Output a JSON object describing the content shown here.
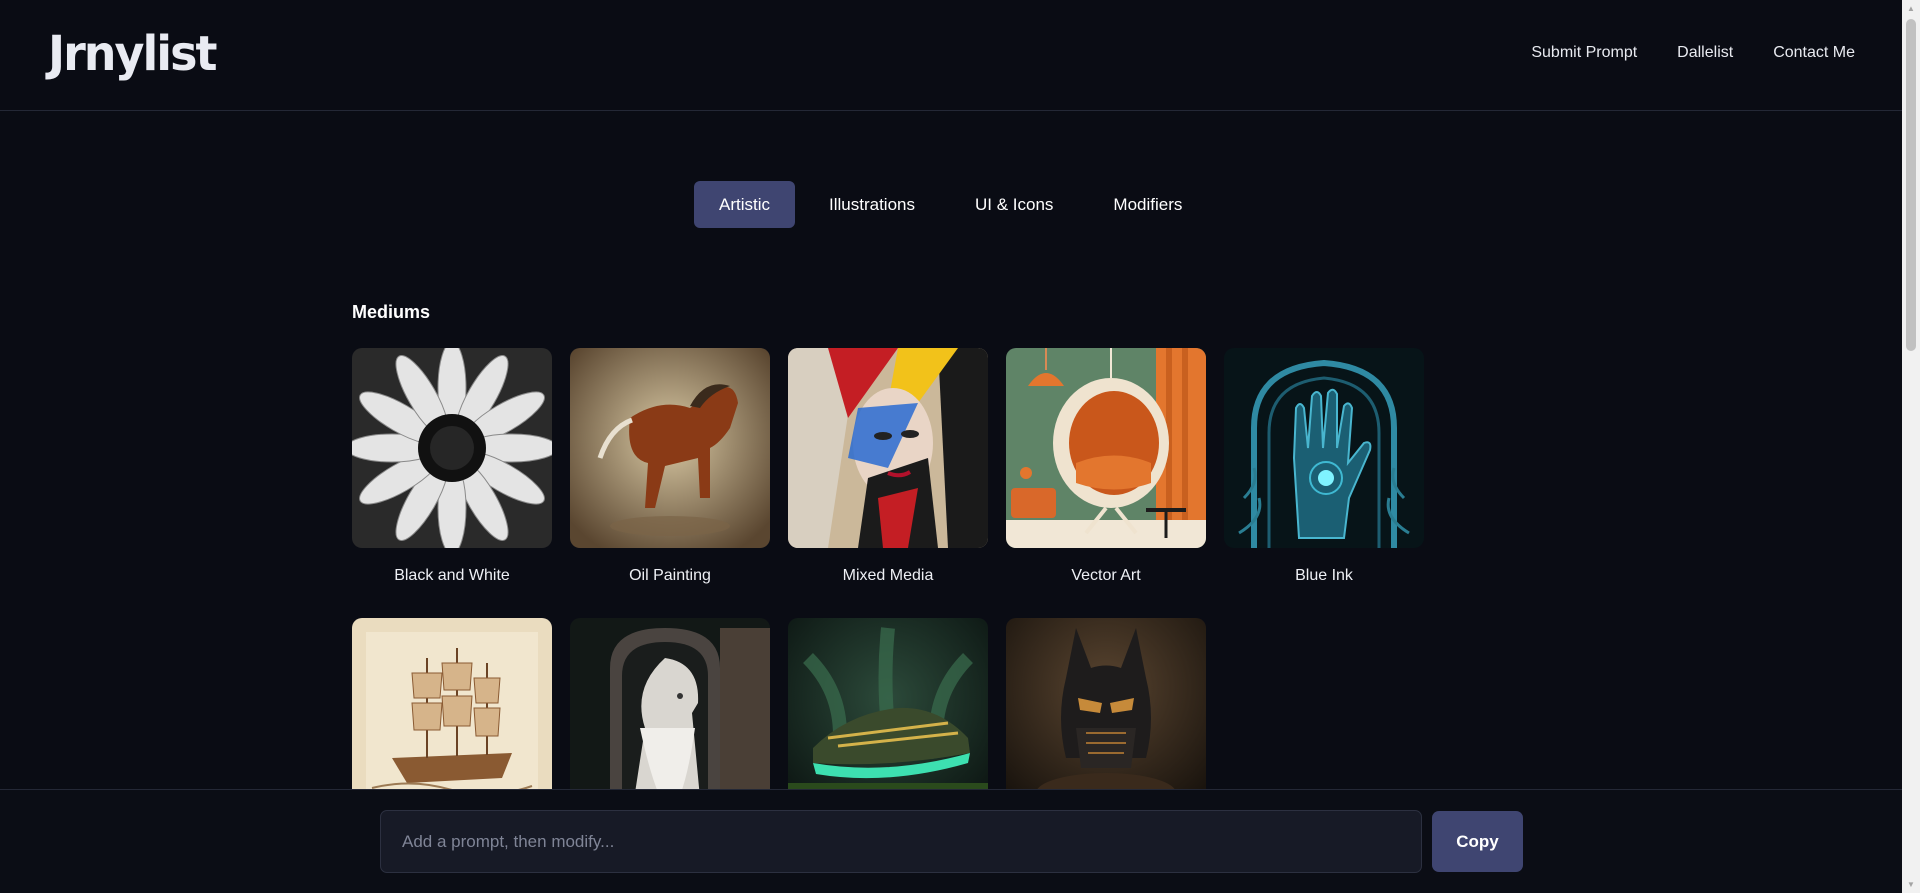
{
  "app": {
    "logo": "Jrnylist"
  },
  "nav": {
    "items": [
      "Submit Prompt",
      "Dallelist",
      "Contact Me"
    ]
  },
  "tabs": [
    {
      "label": "Artistic",
      "active": true
    },
    {
      "label": "Illustrations",
      "active": false
    },
    {
      "label": "UI & Icons",
      "active": false
    },
    {
      "label": "Modifiers",
      "active": false
    }
  ],
  "section": {
    "title": "Mediums"
  },
  "cards": [
    {
      "label": "Black and White",
      "image": "white-sunflower-bw"
    },
    {
      "label": "Oil Painting",
      "image": "galloping-horse"
    },
    {
      "label": "Mixed Media",
      "image": "collage-face"
    },
    {
      "label": "Vector Art",
      "image": "egg-chair-interior"
    },
    {
      "label": "Blue Ink",
      "image": "ornate-blue-hand"
    },
    {
      "label": "",
      "image": "sepia-sailing-ship"
    },
    {
      "label": "",
      "image": "bearded-wizard-relief"
    },
    {
      "label": "",
      "image": "glowing-sneaker"
    },
    {
      "label": "",
      "image": "dark-knight-helmet"
    }
  ],
  "prompt_bar": {
    "placeholder": "Add a prompt, then modify...",
    "value": "",
    "copy_label": "Copy"
  },
  "colors": {
    "background": "#0a0c14",
    "accent": "#3f4571",
    "input_bg": "#171a26"
  }
}
